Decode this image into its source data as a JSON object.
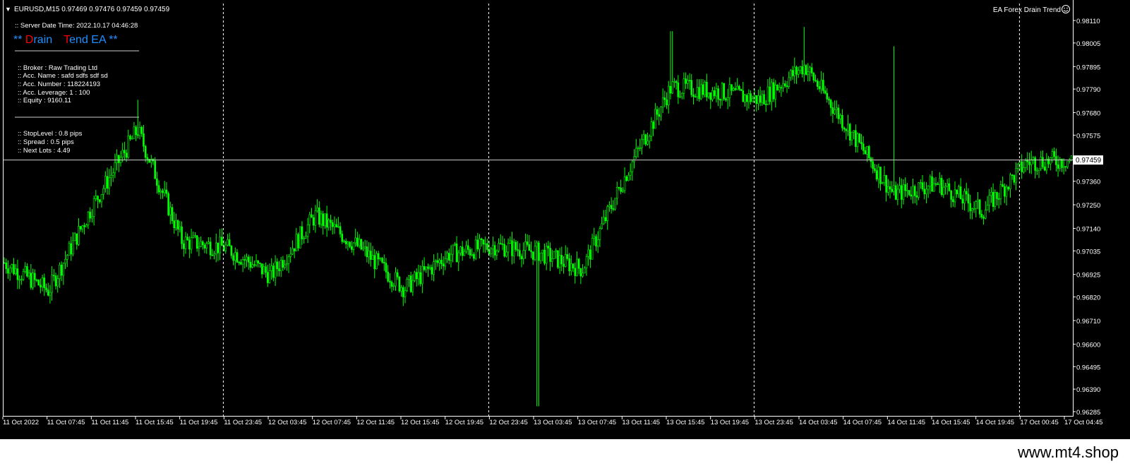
{
  "header": {
    "menu_arrow": "▼",
    "symbol_info": "EURUSD,M15  0.97469 0.97476 0.97459 0.97459",
    "ea_name": "EA Forex Drain Trend",
    "ea_icon": "smiley-icon"
  },
  "ea_panel": {
    "server_time": ":: Server Date Time: 2022.10.17   04:46:28",
    "title_prefix": "** ",
    "title_word1_first": "D",
    "title_word1_rest": "rain",
    "title_word2_first": "T",
    "title_word2_rest": "end EA **",
    "separator": "-------------------------------------------------------",
    "broker": ":: Broker    :    Raw Trading Ltd",
    "acc_name": ":: Acc. Name  :  safd    sdfs sdf  sd",
    "acc_number": ":: Acc. Number   :   118224193",
    "acc_leverage": ":: Acc. Leverage:   1 : 100",
    "equity": ":: Equity    :    9160.11",
    "stop_level": ":: StopLevel  :   0.8 pips",
    "spread": ":: Spread  :   0.5 pips",
    "next_lots": ":: Next Lots  :   4.49"
  },
  "watermark": "www.mt4.shop",
  "colors": {
    "background": "#000000",
    "candles": "#00ff00",
    "grid": "#ffffff",
    "text": "#ffffff",
    "title_accent": "#ff0000",
    "title_blue": "#1e90ff",
    "price_label_bg": "#ffffff",
    "price_label_text": "#000000"
  },
  "chart_data": {
    "type": "candlestick",
    "symbol": "EURUSD",
    "timeframe": "M15",
    "current_price": "0.97459",
    "current_price_value": 0.97459,
    "ylim": [
      0.96285,
      0.9811
    ],
    "y_ticks": [
      "0.98110",
      "0.98005",
      "0.97895",
      "0.97790",
      "0.97680",
      "0.97575",
      "0.97470",
      "0.97360",
      "0.97250",
      "0.97140",
      "0.97035",
      "0.96925",
      "0.96820",
      "0.96710",
      "0.96600",
      "0.96495",
      "0.96390",
      "0.96285"
    ],
    "x_ticks": [
      "11 Oct 2022",
      "11 Oct 07:45",
      "11 Oct 11:45",
      "11 Oct 15:45",
      "11 Oct 19:45",
      "11 Oct 23:45",
      "12 Oct 03:45",
      "12 Oct 07:45",
      "12 Oct 11:45",
      "12 Oct 15:45",
      "12 Oct 19:45",
      "12 Oct 23:45",
      "13 Oct 03:45",
      "13 Oct 07:45",
      "13 Oct 11:45",
      "13 Oct 15:45",
      "13 Oct 19:45",
      "13 Oct 23:45",
      "14 Oct 03:45",
      "14 Oct 07:45",
      "14 Oct 11:45",
      "14 Oct 15:45",
      "14 Oct 19:45",
      "17 Oct 00:45",
      "17 Oct 04:45"
    ],
    "day_separators_after": [
      "11 Oct 19:45",
      "12 Oct 19:45",
      "13 Oct 19:45",
      "14 Oct 19:45"
    ],
    "series": [
      {
        "close_path": [
          [
            "11 Oct 2022",
            0.9698
          ],
          [
            "11 Oct 07:45",
            0.9685
          ],
          [
            "11 Oct 11:45",
            0.9725
          ],
          [
            "11 Oct 15:45",
            0.976
          ],
          [
            "11 Oct 19:45",
            0.9708
          ],
          [
            "11 Oct 23:45",
            0.9705
          ],
          [
            "12 Oct 03:45",
            0.9692
          ],
          [
            "12 Oct 07:45",
            0.972
          ],
          [
            "12 Oct 11:45",
            0.9705
          ],
          [
            "12 Oct 15:45",
            0.9686
          ],
          [
            "12 Oct 19:45",
            0.9702
          ],
          [
            "12 Oct 23:45",
            0.9706
          ],
          [
            "13 Oct 03:45",
            0.9703
          ],
          [
            "13 Oct 07:45",
            0.9695
          ],
          [
            "13 Oct 11:45",
            0.974
          ],
          [
            "13 Oct 15:45",
            0.978
          ],
          [
            "13 Oct 19:45",
            0.9778
          ],
          [
            "13 Oct 23:45",
            0.9774
          ],
          [
            "14 Oct 03:45",
            0.979
          ],
          [
            "14 Oct 07:45",
            0.976
          ],
          [
            "14 Oct 11:45",
            0.973
          ],
          [
            "14 Oct 15:45",
            0.9735
          ],
          [
            "14 Oct 19:45",
            0.9722
          ],
          [
            "17 Oct 00:45",
            0.9745
          ],
          [
            "17 Oct 04:45",
            0.97459
          ]
        ],
        "notable_extremes": [
          [
            "11 Oct 15:45",
            0.9774,
            "high"
          ],
          [
            "13 Oct 03:45",
            0.9631,
            "low_spike_near_13_Oct_12:45"
          ],
          [
            "13 Oct 15:45",
            0.9806,
            "high"
          ],
          [
            "14 Oct 03:45",
            0.9808,
            "high"
          ],
          [
            "14 Oct 11:45",
            0.9799,
            "spike"
          ]
        ]
      }
    ],
    "grid": false
  }
}
